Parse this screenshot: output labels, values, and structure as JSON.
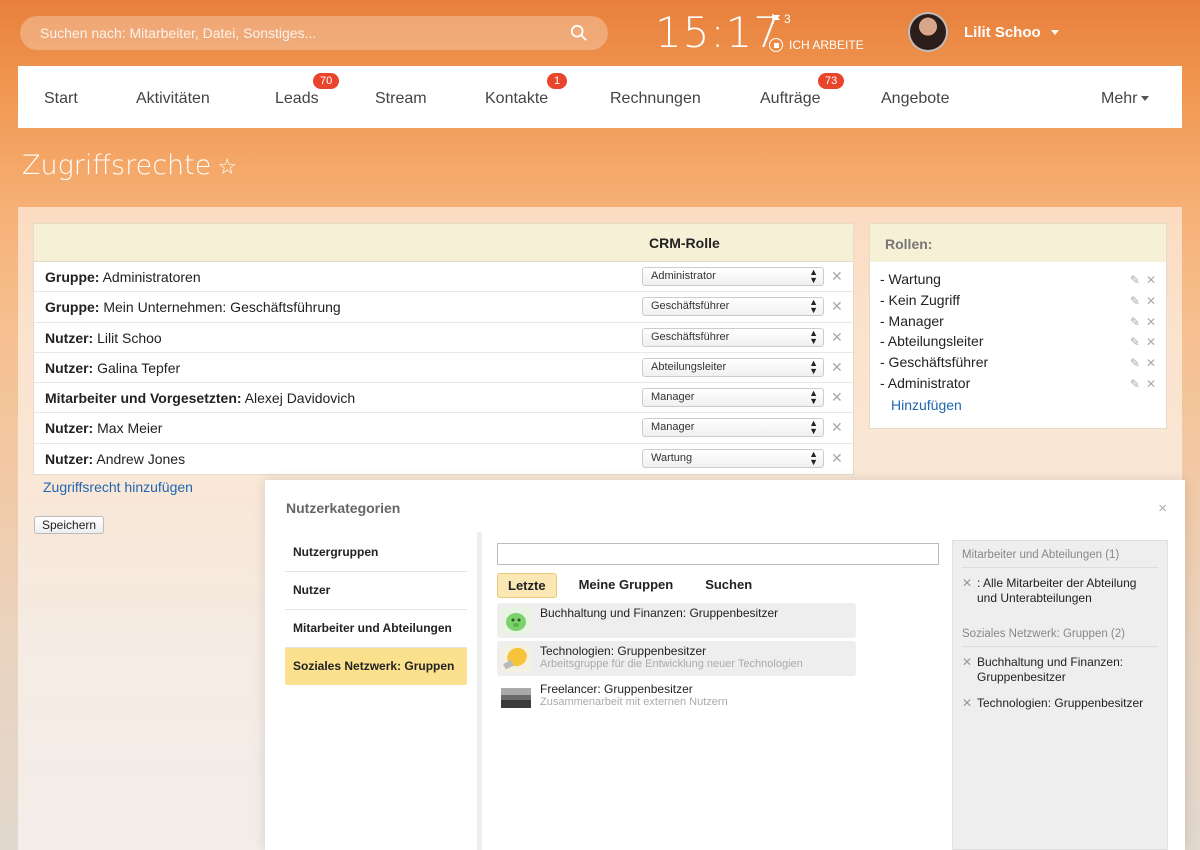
{
  "topbar": {
    "search_placeholder": "Suchen nach: Mitarbeiter, Datei, Sonstiges...",
    "time": "15:17",
    "flag_count": "3",
    "work_status": "ICH ARBEITE",
    "user_name": "Lilit Schoo"
  },
  "nav": {
    "items": [
      {
        "label": "Start"
      },
      {
        "label": "Aktivitäten"
      },
      {
        "label": "Leads",
        "badge": "70"
      },
      {
        "label": "Stream"
      },
      {
        "label": "Kontakte",
        "badge": "1"
      },
      {
        "label": "Rechnungen"
      },
      {
        "label": "Aufträge",
        "badge": "73"
      },
      {
        "label": "Angebote"
      },
      {
        "label": "Mehr"
      }
    ]
  },
  "page": {
    "title": "Zugriffsrechte",
    "star": "☆"
  },
  "rights": {
    "column_header": "CRM-Rolle",
    "rows": [
      {
        "type": "Gruppe:",
        "name": "Administratoren",
        "role": "Administrator"
      },
      {
        "type": "Gruppe:",
        "name": "Mein Unternehmen: Geschäftsführung",
        "role": "Geschäftsführer"
      },
      {
        "type": "Nutzer:",
        "name": "Lilit Schoo",
        "role": "Geschäftsführer"
      },
      {
        "type": "Nutzer:",
        "name": "Galina Tepfer",
        "role": "Abteilungsleiter"
      },
      {
        "type": "Mitarbeiter und Vorgesetzten:",
        "name": "Alexej Davidovich",
        "role": "Manager"
      },
      {
        "type": "Nutzer:",
        "name": "Max Meier",
        "role": "Manager"
      },
      {
        "type": "Nutzer:",
        "name": "Andrew Jones",
        "role": "Wartung"
      }
    ],
    "add_link": "Zugriffsrecht hinzufügen",
    "save_label": "Speichern"
  },
  "roles": {
    "title": "Rollen:",
    "items": [
      "- Wartung",
      "- Kein Zugriff",
      "- Manager",
      "- Abteilungsleiter",
      "- Geschäftsführer",
      "- Administrator"
    ],
    "add_link": "Hinzufügen"
  },
  "popup": {
    "title": "Nutzerkategorien",
    "close": "×",
    "categories": [
      "Nutzergruppen",
      "Nutzer",
      "Mitarbeiter und Abteilungen",
      "Soziales Netzwerk: Gruppen"
    ],
    "tabs": [
      "Letzte",
      "Meine Gruppen",
      "Suchen"
    ],
    "groups": [
      {
        "name": "Buchhaltung und Finanzen: Gruppenbesitzer",
        "desc": ""
      },
      {
        "name": "Technologien: Gruppenbesitzer",
        "desc": "Arbeitsgruppe für die Entwicklung neuer Technologien"
      },
      {
        "name": "Freelancer: Gruppenbesitzer",
        "desc": "Zusammenarbeit mit externen Nutzern"
      }
    ],
    "selected": {
      "section1_title": "Mitarbeiter und Abteilungen (1)",
      "section1_items": [
        ": Alle Mitarbeiter der Abteilung und Unterabteilungen"
      ],
      "section2_title": "Soziales Netzwerk: Gruppen (2)",
      "section2_items": [
        "Buchhaltung und Finanzen: Gruppenbesitzer",
        "Technologien: Gruppenbesitzer"
      ]
    }
  }
}
